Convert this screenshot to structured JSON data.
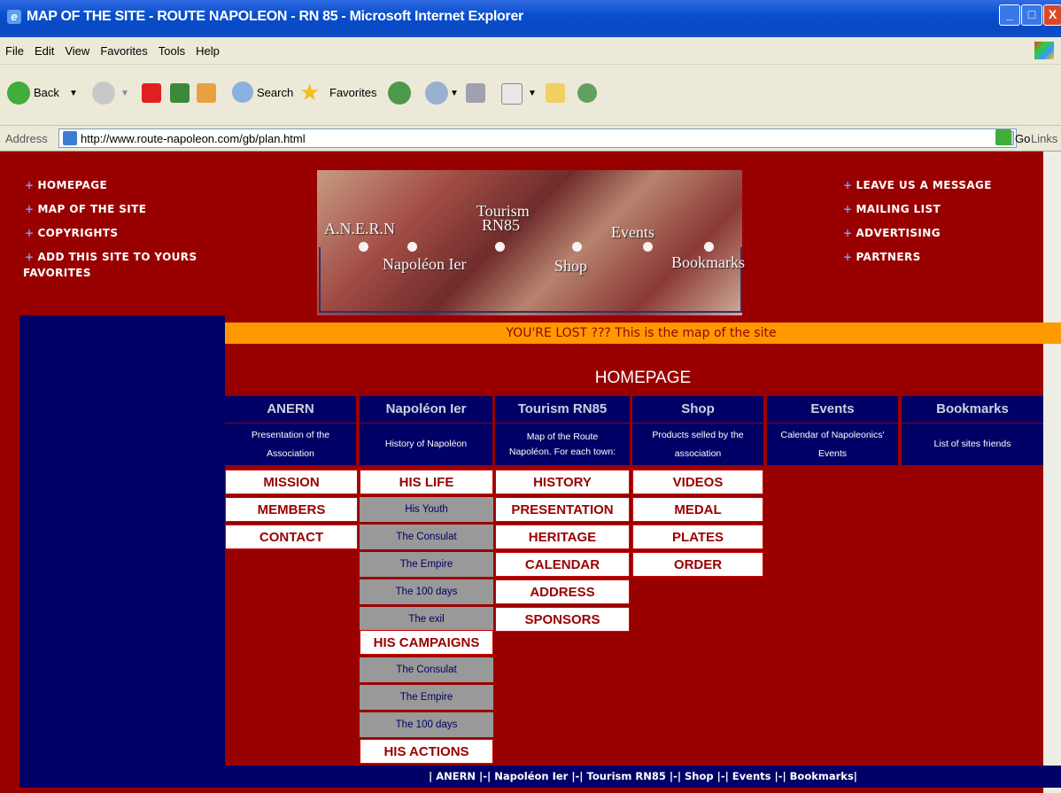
{
  "window": {
    "title": "MAP OF THE SITE - ROUTE NAPOLEON - RN 85 - Microsoft Internet Explorer",
    "buttons": [
      "_",
      "□",
      "X"
    ]
  },
  "menu": [
    "File",
    "Edit",
    "View",
    "Favorites",
    "Tools",
    "Help"
  ],
  "toolbar": {
    "back": "Back",
    "search": "Search",
    "favorites": "Favorites"
  },
  "address": {
    "label": "Address",
    "url": "http://www.route-napoleon.com/gb/plan.html",
    "go": "Go",
    "links": "Links"
  },
  "nav_left": [
    "HOMEPAGE",
    "MAP OF THE SITE",
    "COPYRIGHTS",
    "ADD THIS SITE TO YOURS",
    "FAVORITES"
  ],
  "nav_right": [
    "LEAVE US A MESSAGE",
    "MAILING LIST",
    "ADVERTISING",
    "PARTNERS"
  ],
  "banner": {
    "anern": "A.N.E.R.N",
    "tourism": "Tourism",
    "rn85": "RN85",
    "events": "Events",
    "napoleon": "Napoléon Ier",
    "shop": "Shop",
    "bookmarks": "Bookmarks"
  },
  "lost_text": "YOU'RE LOST ??? This is the map of the site",
  "homepage_heading": "HOMEPAGE",
  "columns": [
    {
      "head": "ANERN",
      "desc1": "Presentation of the",
      "desc2": "Association"
    },
    {
      "head": "Napoléon Ier",
      "desc1": "History of Napoléon",
      "desc2": ""
    },
    {
      "head": "Tourism RN85",
      "desc1": "Map of the Route",
      "desc2": "Napoléon. For each town:"
    },
    {
      "head": "Shop",
      "desc1": "Products selled by the",
      "desc2": "association"
    },
    {
      "head": "Events",
      "desc1": "Calendar of Napoleonics'",
      "desc2": "Events"
    },
    {
      "head": "Bookmarks",
      "desc1": "List of sites friends",
      "desc2": ""
    }
  ],
  "anern_items": [
    "MISSION",
    "MEMBERS",
    "CONTACT"
  ],
  "napoleon_items": [
    {
      "label": "HIS LIFE",
      "kind": "main"
    },
    {
      "label": "His Youth",
      "kind": "sub"
    },
    {
      "label": "The Consulat",
      "kind": "sub"
    },
    {
      "label": "The Empire",
      "kind": "sub"
    },
    {
      "label": "The 100 days",
      "kind": "sub"
    },
    {
      "label": "The exil",
      "kind": "sub"
    },
    {
      "label": "HIS CAMPAIGNS",
      "kind": "main"
    },
    {
      "label": "The Consulat",
      "kind": "sub"
    },
    {
      "label": "The Empire",
      "kind": "sub"
    },
    {
      "label": "The 100 days",
      "kind": "sub"
    },
    {
      "label": "HIS ACTIONS",
      "kind": "main"
    }
  ],
  "tourism_items": [
    "HISTORY",
    "PRESENTATION",
    "HERITAGE",
    "CALENDAR",
    "ADDRESS",
    "SPONSORS"
  ],
  "shop_items": [
    "VIDEOS",
    "MEDAL",
    "PLATES",
    "ORDER"
  ],
  "footer": "| ANERN |-| Napoléon Ier |-| Tourism RN85 |-| Shop |-| Events |-| Bookmarks|",
  "colors": {
    "page_bg": "#990000",
    "blue": "#000066",
    "orange": "#ff9900",
    "grey": "#999999"
  }
}
